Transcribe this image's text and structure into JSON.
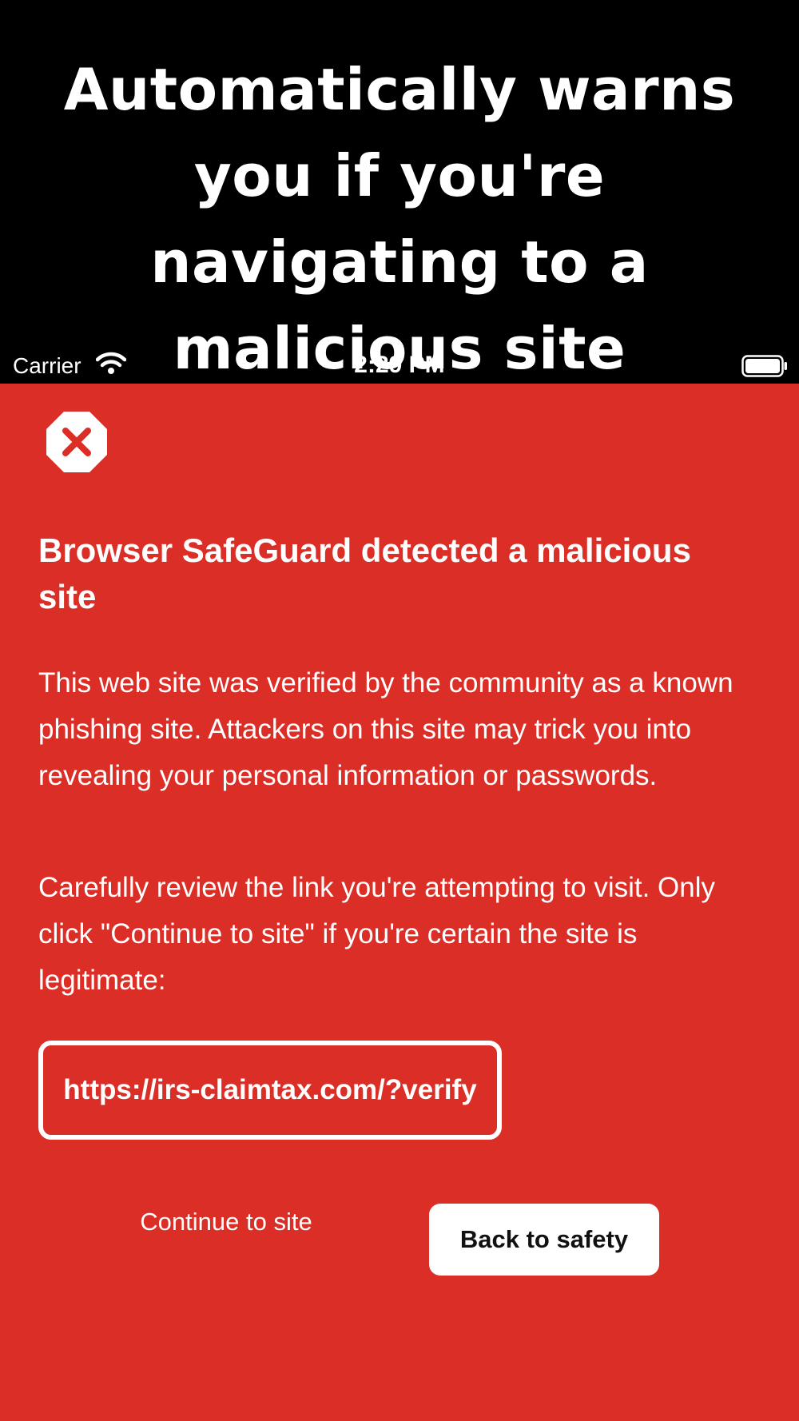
{
  "promo": {
    "title": "Automatically warns you if you're navigating to a malicious site"
  },
  "status_bar": {
    "carrier": "Carrier",
    "time": "2:29 PM"
  },
  "warning": {
    "icon": "stop-x-icon",
    "title": "Browser SafeGuard detected a malicious site",
    "paragraph_1": "This web site was verified by the community as a known phishing site. Attackers on this site may trick you into revealing your personal information or passwords.",
    "paragraph_2": "Carefully review the link you're attempting to visit. Only click \"Continue to site\" if you're certain the site is legitimate:",
    "url": "https://irs-claimtax.com/?verify"
  },
  "actions": {
    "continue_label": "Continue to site",
    "back_label": "Back to safety"
  },
  "colors": {
    "background": "#da2e26",
    "promo_background": "#000000",
    "text": "#ffffff"
  }
}
